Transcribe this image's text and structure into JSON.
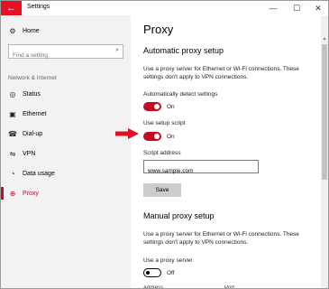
{
  "window": {
    "title": "Settings",
    "back_icon": "back-arrow-icon",
    "min_glyph": "—",
    "max_glyph": "☐",
    "close_glyph": "✕"
  },
  "sidebar": {
    "home_label": "Home",
    "home_icon_glyph": "⚙",
    "search_placeholder": "Find a setting",
    "search_icon_glyph": "⌕",
    "section_label": "Network & Internet",
    "items": [
      {
        "label": "Status",
        "icon": "globe-icon",
        "glyph": "◎"
      },
      {
        "label": "Ethernet",
        "icon": "ethernet-icon",
        "glyph": "▣"
      },
      {
        "label": "Dial-up",
        "icon": "phone-icon",
        "glyph": "☎"
      },
      {
        "label": "VPN",
        "icon": "vpn-icon",
        "glyph": "⇋"
      },
      {
        "label": "Data usage",
        "icon": "clock-icon",
        "glyph": "◔"
      },
      {
        "label": "Proxy",
        "icon": "globe-icon",
        "glyph": "⊕"
      }
    ],
    "active_item": "Proxy",
    "accent_color": "#c10c28"
  },
  "main": {
    "page_title": "Proxy",
    "automatic": {
      "heading": "Automatic proxy setup",
      "description": "Use a proxy server for Ethernet or Wi-Fi connections. These settings don't apply to VPN connections.",
      "detect_label": "Automatically detect settings",
      "detect_state": "On",
      "script_label": "Use setup script",
      "script_state": "On",
      "address_label": "Script address",
      "address_value": "www.sample.com",
      "save_label": "Save"
    },
    "manual": {
      "heading": "Manual proxy setup",
      "description": "Use a proxy server for Ethernet or Wi-Fi connections. These settings don't apply to VPN connections.",
      "use_proxy_label": "Use a proxy server",
      "use_proxy_state": "Off",
      "address_label": "Address",
      "port_label": "Port"
    }
  },
  "annotation": {
    "arrow_color": "#e01020"
  }
}
